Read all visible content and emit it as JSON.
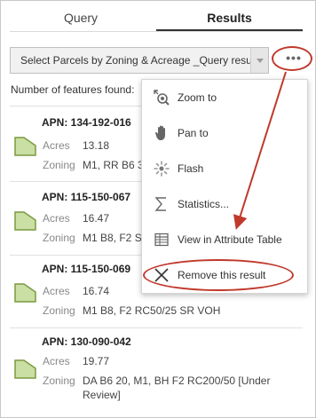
{
  "tabs": [
    {
      "label": "Query"
    },
    {
      "label": "Results"
    }
  ],
  "query_select": {
    "selected": "Select Parcels by Zoning & Acreage _Query results"
  },
  "more_button": {
    "label": "•••"
  },
  "feature_count_label": "Number of features found:",
  "results": [
    {
      "apn": "APN: 134-192-016",
      "acres_label": "Acres",
      "acres": "13.18",
      "zoning_label": "Zoning",
      "zoning": "M1, RR B6 3"
    },
    {
      "apn": "APN: 115-150-067",
      "acres_label": "Acres",
      "acres": "16.47",
      "zoning_label": "Zoning",
      "zoning": "M1 B8, F2 S"
    },
    {
      "apn": "APN: 115-150-069",
      "acres_label": "Acres",
      "acres": "16.74",
      "zoning_label": "Zoning",
      "zoning": "M1 B8, F2 RC50/25 SR VOH"
    },
    {
      "apn": "APN: 130-090-042",
      "acres_label": "Acres",
      "acres": "19.77",
      "zoning_label": "Zoning",
      "zoning_line1": "DA B6 20, M1, BH F2 RC200/50 [Under",
      "zoning_line2": "Review]"
    }
  ],
  "menu": {
    "items": [
      {
        "label": "Zoom to",
        "icon": "zoom-to-icon"
      },
      {
        "label": "Pan to",
        "icon": "pan-to-icon"
      },
      {
        "label": "Flash",
        "icon": "flash-icon"
      },
      {
        "label": "Statistics...",
        "icon": "statistics-icon"
      },
      {
        "label": "View in Attribute Table",
        "icon": "attribute-table-icon"
      },
      {
        "label": "Remove this result",
        "icon": "close-icon"
      }
    ]
  },
  "colors": {
    "annotation": "#c0392b",
    "parcel_fill": "#c9dfa4",
    "parcel_stroke": "#7a9a3e"
  }
}
